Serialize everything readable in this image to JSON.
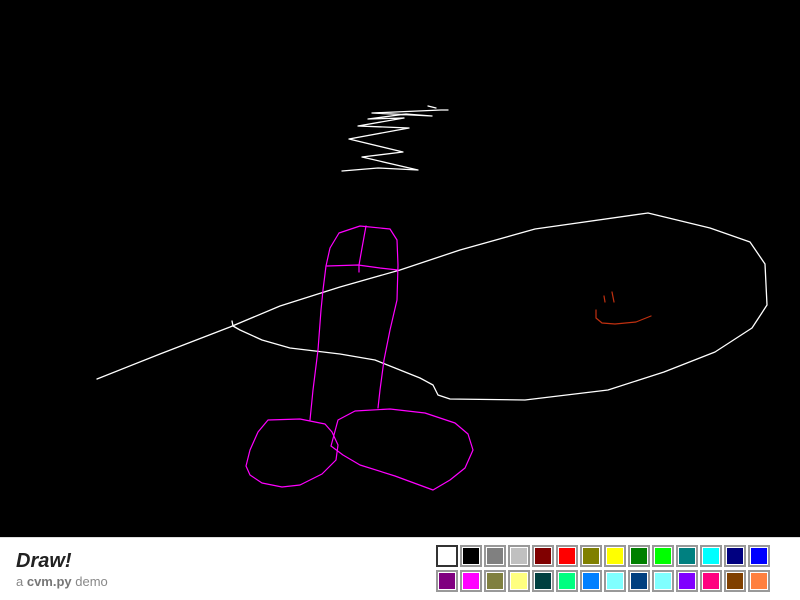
{
  "app": {
    "title": "Draw!",
    "subtitle_prefix": "a ",
    "subtitle_strong": "cvm.py",
    "subtitle_suffix": " demo"
  },
  "palette": {
    "selected_index": 0,
    "colors": [
      "#ffffff",
      "#000000",
      "#808080",
      "#c0c0c0",
      "#800000",
      "#ff0000",
      "#808000",
      "#ffff00",
      "#008000",
      "#00ff00",
      "#008080",
      "#00ffff",
      "#000080",
      "#0000ff",
      "#800080",
      "#ff00ff",
      "#808040",
      "#ffff80",
      "#004040",
      "#00ff80",
      "#0080ff",
      "#80ffff",
      "#004080",
      "#80ffff",
      "#8000ff",
      "#ff0080",
      "#804000",
      "#ff8040"
    ]
  },
  "drawing": {
    "background": "#000000",
    "stroke_colors": {
      "white": "#ffffff",
      "magenta": "#ff00ff",
      "red": "#c03010"
    }
  }
}
